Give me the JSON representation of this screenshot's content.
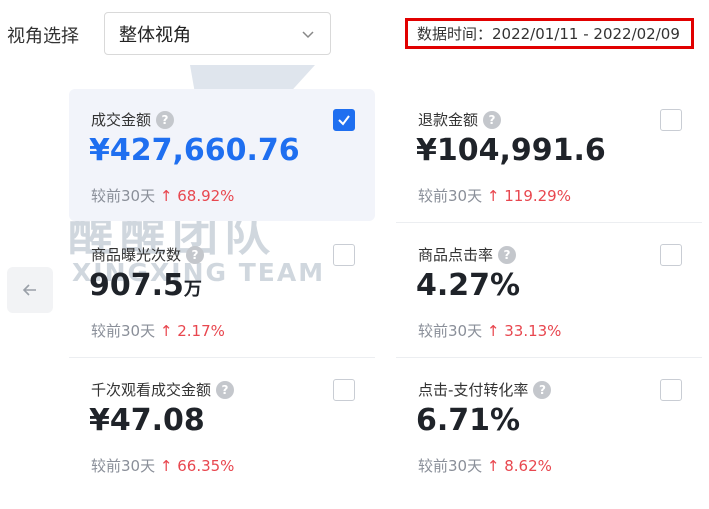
{
  "filter": {
    "label": "视角选择",
    "selected": "整体视角"
  },
  "date_range": "数据时间：2022/01/11 - 2022/02/09",
  "watermark": {
    "text_cn": "醒醒团队",
    "text_en": "XINGXING TEAM"
  },
  "metrics": [
    {
      "title": "成交金额",
      "value": "¥427,660.76",
      "unit": "",
      "compare_label": "较前30天",
      "change": "68.92%",
      "checked": true
    },
    {
      "title": "退款金额",
      "value": "¥104,991.6",
      "unit": "",
      "compare_label": "较前30天",
      "change": "119.29%",
      "checked": false
    },
    {
      "title": "商品曝光次数",
      "value": "907.5",
      "unit": "万",
      "compare_label": "较前30天",
      "change": "2.17%",
      "checked": false
    },
    {
      "title": "商品点击率",
      "value": "4.27%",
      "unit": "",
      "compare_label": "较前30天",
      "change": "33.13%",
      "checked": false
    },
    {
      "title": "千次观看成交金额",
      "value": "¥47.08",
      "unit": "",
      "compare_label": "较前30天",
      "change": "66.35%",
      "checked": false
    },
    {
      "title": "点击-支付转化率",
      "value": "6.71%",
      "unit": "",
      "compare_label": "较前30天",
      "change": "8.62%",
      "checked": false
    }
  ],
  "colors": {
    "accent": "#1f6ff0",
    "increase": "#e8474f",
    "highlight_border": "#e10000"
  }
}
